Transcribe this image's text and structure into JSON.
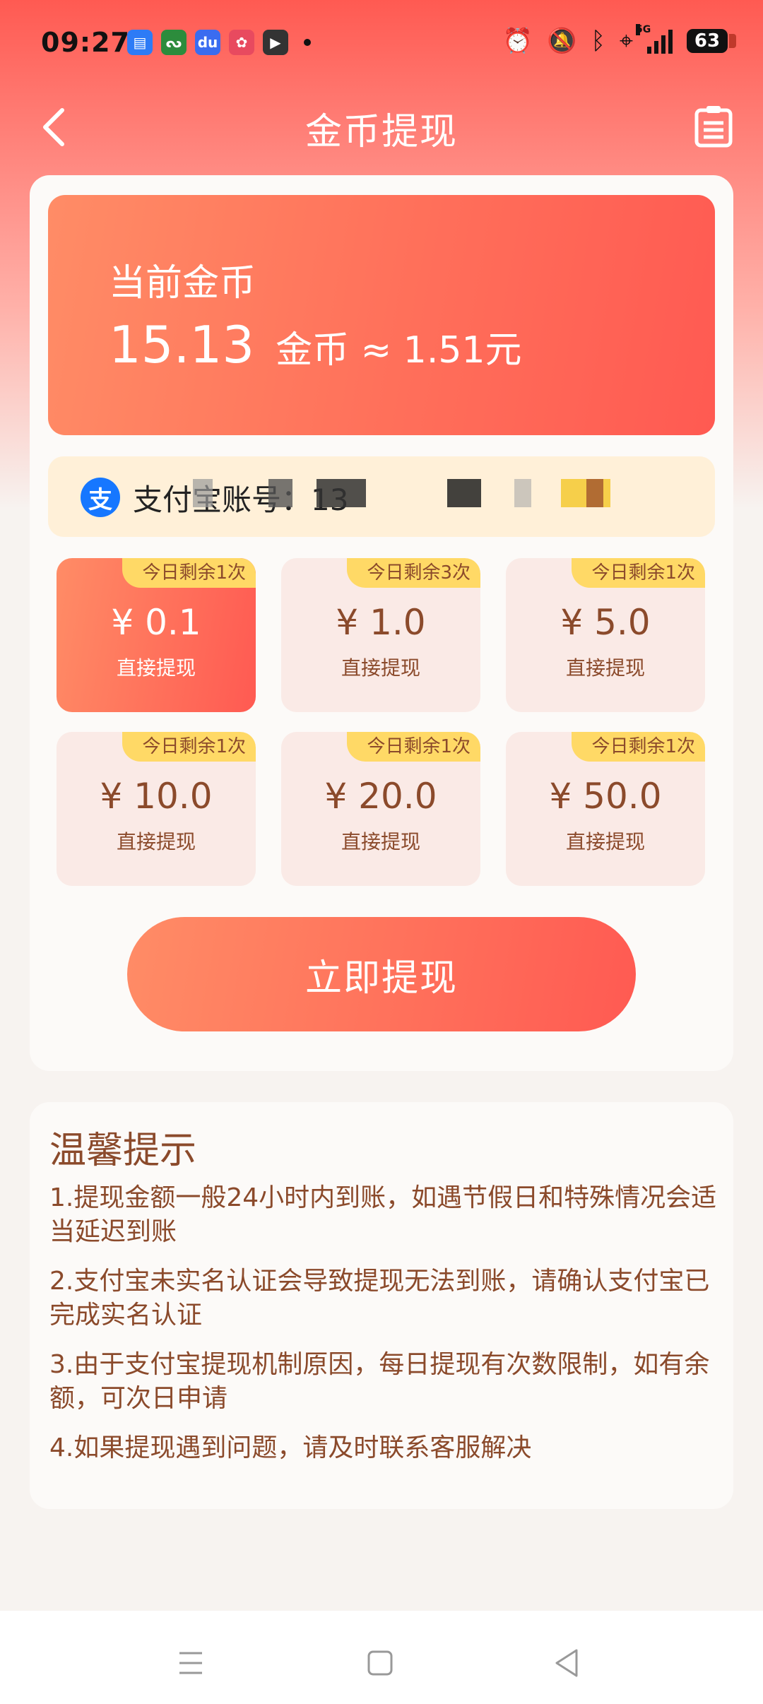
{
  "status_bar": {
    "time": "09:27",
    "network": "5G",
    "battery": "63"
  },
  "header": {
    "title": "金币提现"
  },
  "coin_panel": {
    "label": "当前金币",
    "amount": "15.13",
    "unit_text": "金币 ≈ 1.51元"
  },
  "alipay": {
    "icon_char": "支",
    "account_label": "支付宝账号：13",
    "brand_color": "#1677ff"
  },
  "amounts": [
    {
      "badge": "今日剩余1次",
      "value": "¥ 0.1",
      "label": "直接提现",
      "selected": true
    },
    {
      "badge": "今日剩余3次",
      "value": "¥ 1.0",
      "label": "直接提现",
      "selected": false
    },
    {
      "badge": "今日剩余1次",
      "value": "¥ 5.0",
      "label": "直接提现",
      "selected": false
    },
    {
      "badge": "今日剩余1次",
      "value": "¥ 10.0",
      "label": "直接提现",
      "selected": false
    },
    {
      "badge": "今日剩余1次",
      "value": "¥ 20.0",
      "label": "直接提现",
      "selected": false
    },
    {
      "badge": "今日剩余1次",
      "value": "¥ 50.0",
      "label": "直接提现",
      "selected": false
    }
  ],
  "withdraw_button": "立即提现",
  "tips": {
    "title": "温馨提示",
    "items": [
      "1.提现金额一般24小时内到账，如遇节假日和特殊情况会适当延迟到账",
      "2.支付宝未实名认证会导致提现无法到账，请确认支付宝已完成实名认证",
      "3.由于支付宝提现机制原因，每日提现有次数限制，如有余额，可次日申请",
      "4.如果提现遇到问题，请及时联系客服解决"
    ]
  },
  "colors": {
    "accent": "#ff5a52",
    "accent_light": "#ff8c66",
    "badge": "#ffd966",
    "text_brown": "#8b4a2b"
  },
  "icons": [
    "back-chevron-icon",
    "list-icon",
    "alarm-icon",
    "mute-bell-icon",
    "bluetooth-icon",
    "location-icon",
    "menu-icon",
    "home-square-icon",
    "back-triangle-icon"
  ]
}
